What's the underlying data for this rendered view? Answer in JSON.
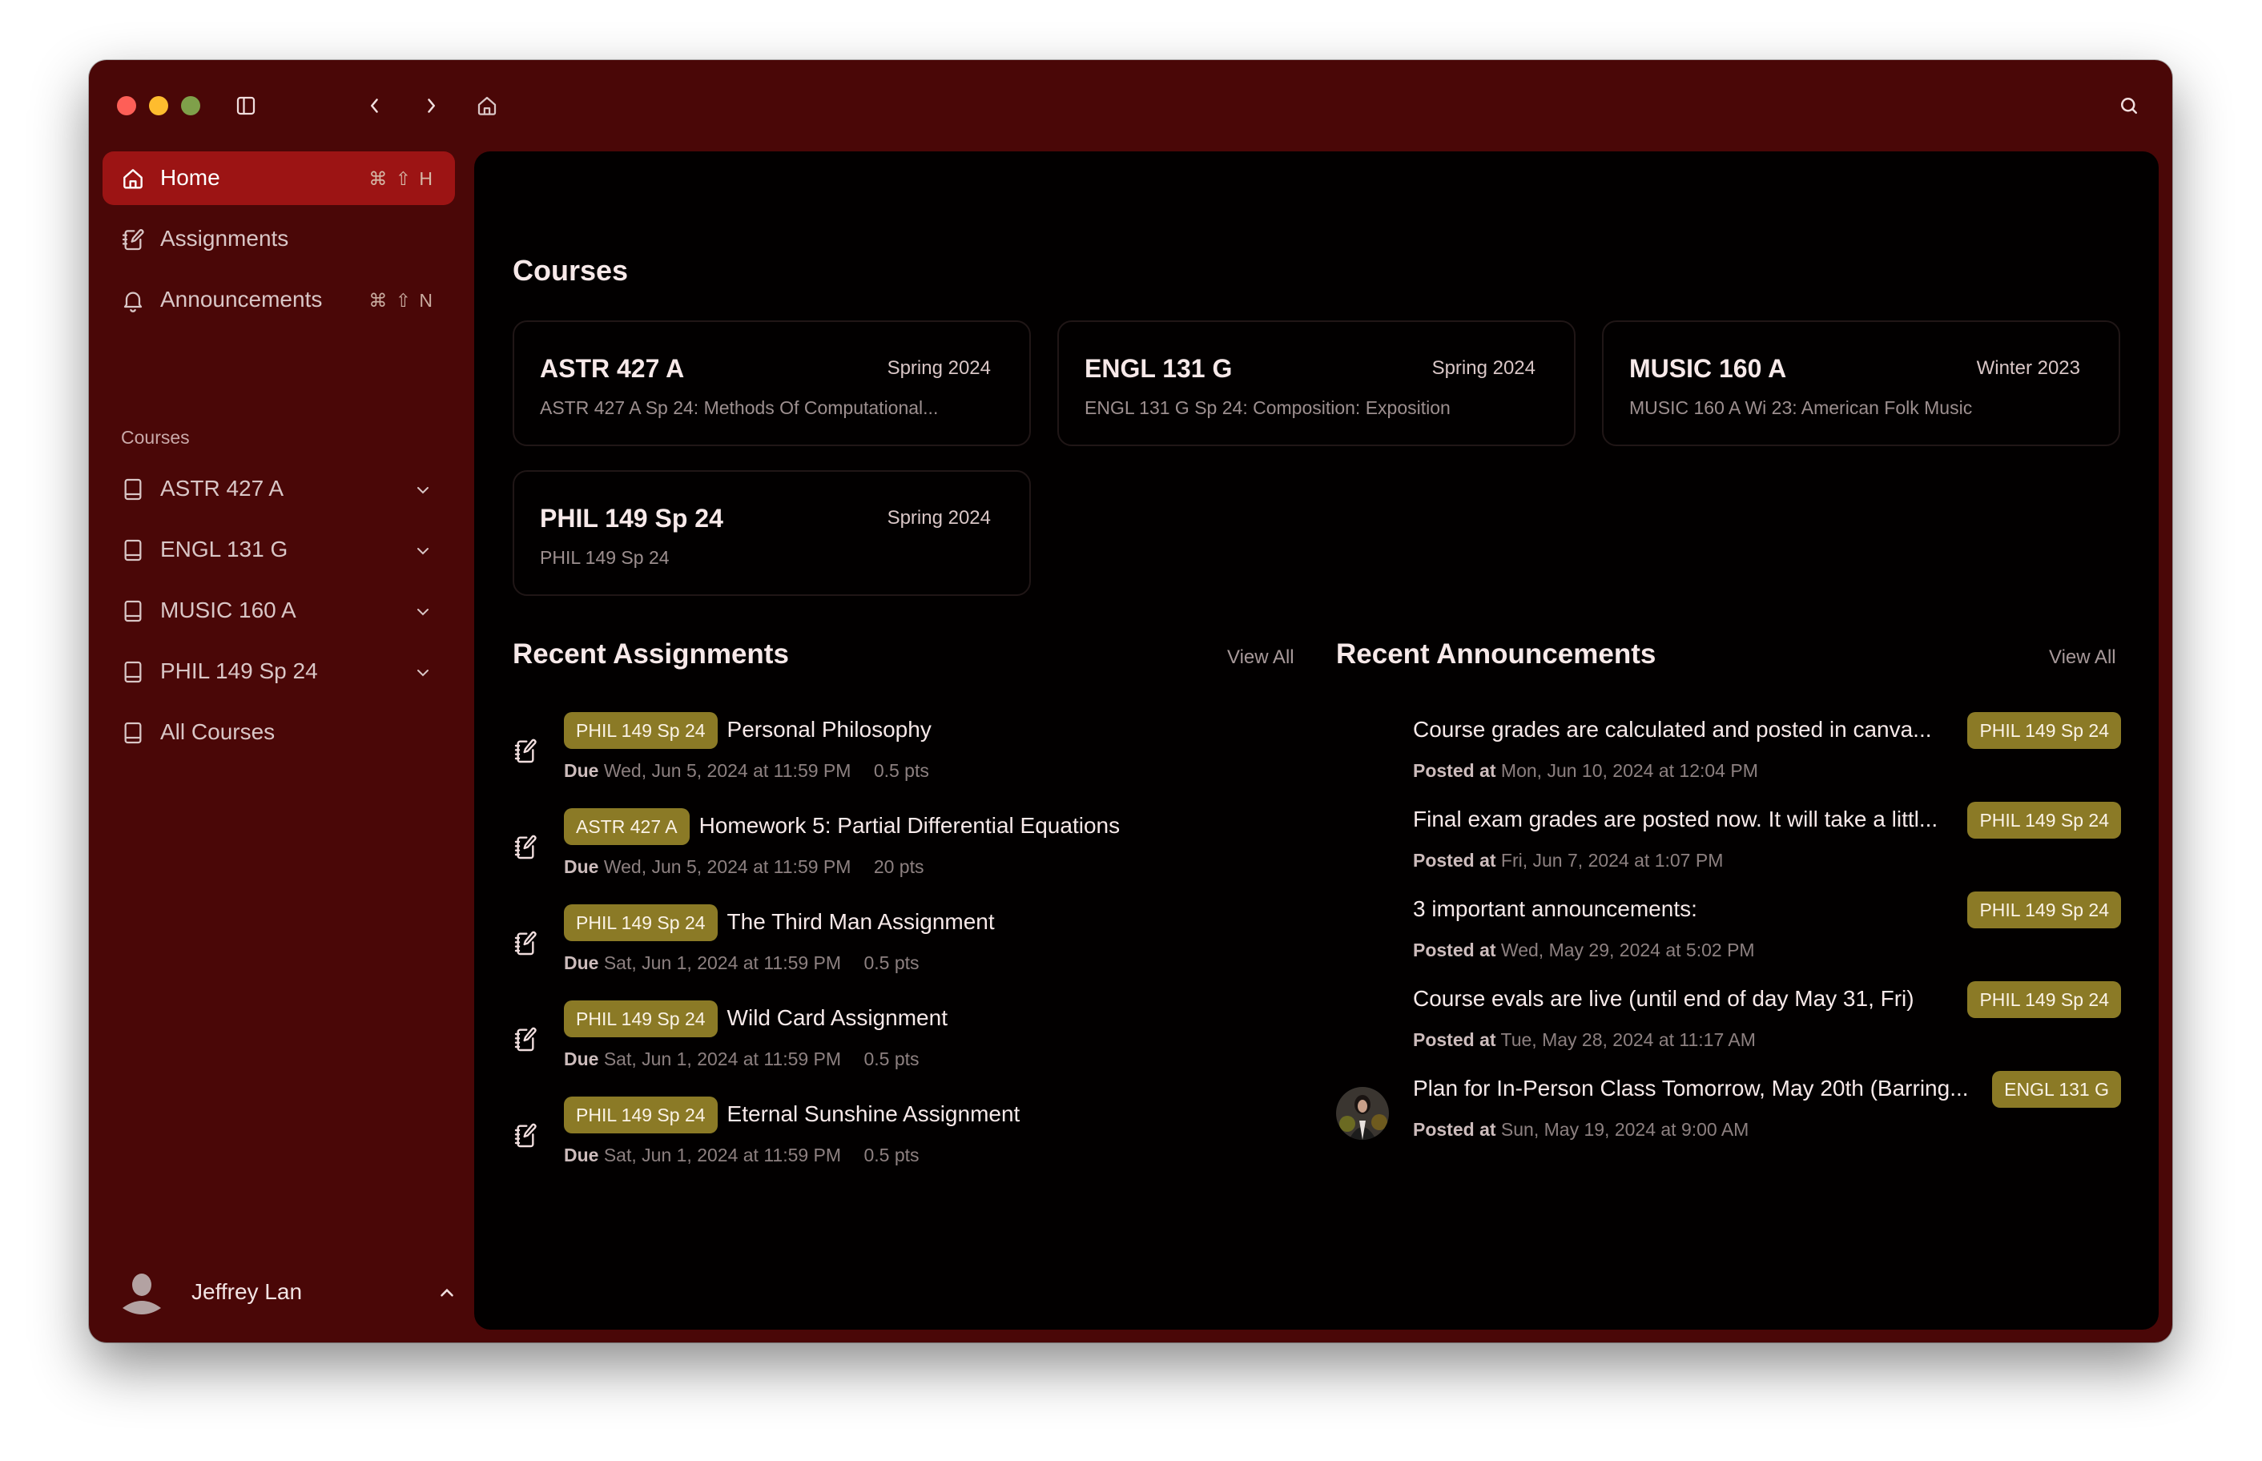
{
  "window": {
    "traffic_lights": [
      "close",
      "minimize",
      "maximize"
    ],
    "toolbar_icons": [
      "sidebar-toggle-icon",
      "chevron-left-icon",
      "chevron-right-icon",
      "home-icon",
      "search-icon"
    ]
  },
  "sidebar": {
    "nav": [
      {
        "label": "Home",
        "icon": "home-icon",
        "shortcut": "⌘ ⇧ H",
        "active": true
      },
      {
        "label": "Assignments",
        "icon": "notebook-pen-icon",
        "shortcut": "",
        "active": false
      },
      {
        "label": "Announcements",
        "icon": "bell-icon",
        "shortcut": "⌘ ⇧ N",
        "active": false
      }
    ],
    "courses_label": "Courses",
    "courses": [
      {
        "label": "ASTR 427 A",
        "icon": "book-icon",
        "expandable": true
      },
      {
        "label": "ENGL 131 G",
        "icon": "book-icon",
        "expandable": true
      },
      {
        "label": "MUSIC 160 A",
        "icon": "book-icon",
        "expandable": true
      },
      {
        "label": "PHIL 149 Sp 24",
        "icon": "book-icon",
        "expandable": true
      },
      {
        "label": "All Courses",
        "icon": "book-icon",
        "expandable": false
      }
    ],
    "user": {
      "name": "Jeffrey Lan",
      "icon": "user-avatar-icon"
    }
  },
  "main": {
    "courses_title": "Courses",
    "course_cards": [
      {
        "code": "ASTR 427 A",
        "term": "Spring 2024",
        "subtitle": "ASTR 427 A Sp 24: Methods Of Computational..."
      },
      {
        "code": "ENGL 131 G",
        "term": "Spring 2024",
        "subtitle": "ENGL 131 G Sp 24: Composition: Exposition"
      },
      {
        "code": "MUSIC 160 A",
        "term": "Winter 2023",
        "subtitle": "MUSIC 160 A Wi 23: American Folk Music"
      },
      {
        "code": "PHIL 149 Sp 24",
        "term": "Spring 2024",
        "subtitle": "PHIL 149 Sp 24"
      }
    ],
    "assignments": {
      "title": "Recent Assignments",
      "view_all": "View All",
      "due_label": "Due",
      "items": [
        {
          "course": "PHIL 149 Sp 24",
          "title": "Personal Philosophy",
          "due": "Wed, Jun 5, 2024 at 11:59 PM",
          "points": "0.5 pts"
        },
        {
          "course": "ASTR 427 A",
          "title": "Homework 5: Partial Differential Equations",
          "due": "Wed, Jun 5, 2024 at 11:59 PM",
          "points": "20 pts"
        },
        {
          "course": "PHIL 149 Sp 24",
          "title": "The Third Man Assignment",
          "due": "Sat, Jun 1, 2024 at 11:59 PM",
          "points": "0.5 pts"
        },
        {
          "course": "PHIL 149 Sp 24",
          "title": "Wild Card Assignment",
          "due": "Sat, Jun 1, 2024 at 11:59 PM",
          "points": "0.5 pts"
        },
        {
          "course": "PHIL 149 Sp 24",
          "title": "Eternal Sunshine Assignment",
          "due": "Sat, Jun 1, 2024 at 11:59 PM",
          "points": "0.5 pts"
        }
      ]
    },
    "announcements": {
      "title": "Recent Announcements",
      "view_all": "View All",
      "posted_label": "Posted at",
      "items": [
        {
          "title": "Course grades are calculated and posted in canva...",
          "posted": "Mon, Jun 10, 2024 at 12:04 PM",
          "course": "PHIL 149 Sp 24",
          "has_avatar": false
        },
        {
          "title": "Final exam grades are posted now. It will take a littl...",
          "posted": "Fri, Jun 7, 2024 at 1:07 PM",
          "course": "PHIL 149 Sp 24",
          "has_avatar": false
        },
        {
          "title": "3 important announcements:",
          "posted": "Wed, May 29, 2024 at 5:02 PM",
          "course": "PHIL 149 Sp 24",
          "has_avatar": false
        },
        {
          "title": "Course evals are live (until end of day May 31, Fri)",
          "posted": "Tue, May 28, 2024 at 11:17 AM",
          "course": "PHIL 149 Sp 24",
          "has_avatar": false
        },
        {
          "title": "Plan for In-Person Class Tomorrow, May 20th (Barring...",
          "posted": "Sun, May 19, 2024 at 9:00 AM",
          "course": "ENGL 131 G",
          "has_avatar": true
        }
      ]
    }
  },
  "colors": {
    "window_bg": "#4a0707",
    "active_nav": "#9c1414",
    "content_bg": "#020000",
    "badge": "#8b7a26",
    "traffic_close": "#fe5f57",
    "traffic_min": "#febc2e",
    "traffic_max": "#7fa04a"
  }
}
